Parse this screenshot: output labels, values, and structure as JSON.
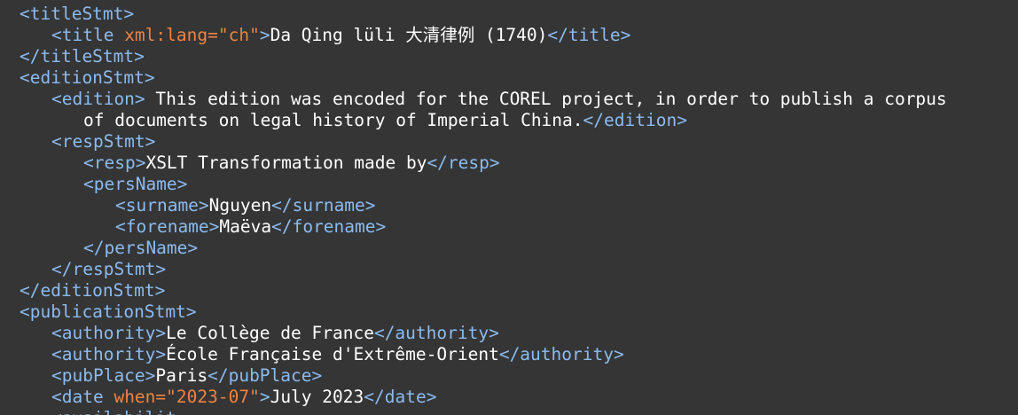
{
  "editor": {
    "language": "xml",
    "lines": [
      {
        "indent": 1,
        "tokens": [
          [
            "tag",
            "<titleStmt>"
          ]
        ]
      },
      {
        "indent": 2,
        "tokens": [
          [
            "tag",
            "<title "
          ],
          [
            "attr",
            "xml:lang="
          ],
          [
            "val",
            "\"ch\""
          ],
          [
            "tag",
            ">"
          ],
          [
            "text",
            "Da Qing lüli 大清律例 (1740)"
          ],
          [
            "tag",
            "</title>"
          ]
        ]
      },
      {
        "indent": 1,
        "tokens": [
          [
            "tag",
            "</titleStmt>"
          ]
        ]
      },
      {
        "indent": 1,
        "tokens": [
          [
            "tag",
            "<editionStmt>"
          ]
        ]
      },
      {
        "indent": 2,
        "tokens": [
          [
            "tag",
            "<edition>"
          ],
          [
            "text",
            " This edition was encoded for the COREL project, in order to publish a corpus"
          ]
        ]
      },
      {
        "indent": 3,
        "tokens": [
          [
            "text",
            "of documents on legal history of Imperial China."
          ],
          [
            "tag",
            "</edition>"
          ]
        ]
      },
      {
        "indent": 2,
        "tokens": [
          [
            "tag",
            "<respStmt>"
          ]
        ]
      },
      {
        "indent": 3,
        "tokens": [
          [
            "tag",
            "<resp>"
          ],
          [
            "text",
            "XSLT Transformation made by"
          ],
          [
            "tag",
            "</resp>"
          ]
        ]
      },
      {
        "indent": 3,
        "tokens": [
          [
            "tag",
            "<persName>"
          ]
        ]
      },
      {
        "indent": 4,
        "tokens": [
          [
            "tag",
            "<surname>"
          ],
          [
            "text",
            "Nguyen"
          ],
          [
            "tag",
            "</surname>"
          ]
        ]
      },
      {
        "indent": 4,
        "tokens": [
          [
            "tag",
            "<forename>"
          ],
          [
            "text",
            "Maëva"
          ],
          [
            "tag",
            "</forename>"
          ]
        ]
      },
      {
        "indent": 3,
        "tokens": [
          [
            "tag",
            "</persName>"
          ]
        ]
      },
      {
        "indent": 2,
        "tokens": [
          [
            "tag",
            "</respStmt>"
          ]
        ]
      },
      {
        "indent": 1,
        "tokens": [
          [
            "tag",
            "</editionStmt>"
          ]
        ]
      },
      {
        "indent": 1,
        "tokens": [
          [
            "tag",
            "<publicationStmt>"
          ]
        ]
      },
      {
        "indent": 2,
        "tokens": [
          [
            "tag",
            "<authority>"
          ],
          [
            "text",
            "Le Collège de France"
          ],
          [
            "tag",
            "</authority>"
          ]
        ]
      },
      {
        "indent": 2,
        "tokens": [
          [
            "tag",
            "<authority>"
          ],
          [
            "text",
            "École Française d'Extrême-Orient"
          ],
          [
            "tag",
            "</authority>"
          ]
        ]
      },
      {
        "indent": 2,
        "tokens": [
          [
            "tag",
            "<pubPlace>"
          ],
          [
            "text",
            "Paris"
          ],
          [
            "tag",
            "</pubPlace>"
          ]
        ]
      },
      {
        "indent": 2,
        "tokens": [
          [
            "tag",
            "<date "
          ],
          [
            "attr",
            "when="
          ],
          [
            "val",
            "\"2023-07\""
          ],
          [
            "tag",
            ">"
          ],
          [
            "text",
            "July 2023"
          ],
          [
            "tag",
            "</date>"
          ]
        ]
      },
      {
        "indent": 2,
        "tokens": [
          [
            "tag",
            "<availabilit"
          ]
        ]
      }
    ],
    "colors": {
      "background": "#353535",
      "tag": "#8bbbf0",
      "attribute": "#ee8344",
      "text": "#ffffff"
    }
  }
}
